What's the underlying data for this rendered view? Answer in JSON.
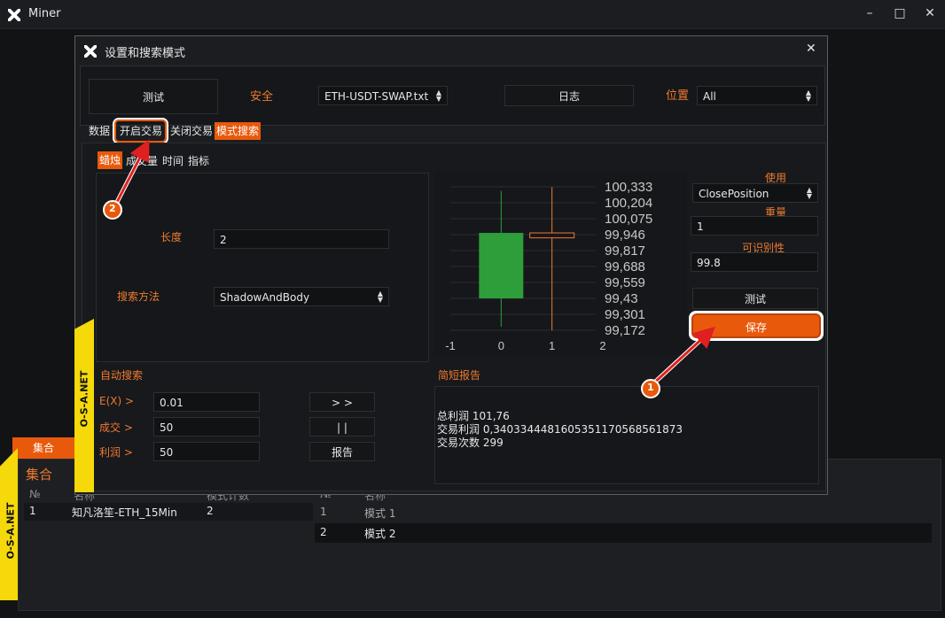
{
  "main": {
    "title": "Miner",
    "window_buttons": {
      "minimize": "–",
      "maximize": "□",
      "close": "✕"
    }
  },
  "collection": {
    "tab_label": "集合",
    "title": "集合",
    "left_headers": [
      "№",
      "名称",
      "模式计数"
    ],
    "left_rows": [
      [
        "1",
        "知凡洛笙-ETH_15Min",
        "2"
      ]
    ],
    "right_headers": [
      "№",
      "名称"
    ],
    "right_rows": [
      [
        "1",
        "模式 1"
      ],
      [
        "2",
        "模式 2"
      ]
    ]
  },
  "dialog": {
    "title": "设置和搜索模式",
    "close": "✕",
    "top": {
      "test_button": "测试",
      "security_label": "安全",
      "security_value": "ETH-USDT-SWAP.txt",
      "log_button": "日志",
      "position_label": "位置",
      "position_value": "All"
    },
    "tabs": [
      "数据",
      "开启交易",
      "关闭交易",
      "模式搜索"
    ],
    "active_tab": "模式搜索",
    "subtabs": [
      "蜡烛",
      "成交量",
      "时间",
      "指标"
    ],
    "params": {
      "length_label": "长度",
      "length_value": "2",
      "method_label": "搜索方法",
      "method_value": "ShadowAndBody"
    },
    "auto_search": {
      "title": "自动搜索",
      "rows": [
        {
          "label": "E(X) >",
          "value": "0.01",
          "button": "> >"
        },
        {
          "label": "成交 >",
          "value": "50",
          "button": "| |"
        },
        {
          "label": "利润 >",
          "value": "50",
          "button": "报告"
        }
      ]
    },
    "right_panel": {
      "use_label": "使用",
      "use_value": "ClosePosition",
      "weight_label": "重量",
      "weight_value": "1",
      "recognition_label": "可识别性",
      "recognition_value": "99.8",
      "test_button": "测试",
      "save_button": "保存"
    },
    "report": {
      "title": "简短报告",
      "lines": [
        "总利润 101,76",
        "交易利润 0,34033444816053511705685618​73",
        "交易次数 299"
      ]
    }
  },
  "chart_data": {
    "type": "candlestick",
    "x_ticks": [
      "-1",
      "0",
      "1",
      "2"
    ],
    "y_ticks": [
      "100,333",
      "100,204",
      "100,075",
      "99,946",
      "99,817",
      "99,688",
      "99,559",
      "99,43",
      "99,301",
      "99,172"
    ],
    "candles": [
      {
        "x": 0,
        "open": 99.43,
        "close": 99.96,
        "high": 100.3,
        "low": 99.2,
        "color": "#2e9e3a"
      },
      {
        "x": 1,
        "open": 99.96,
        "close": 99.92,
        "high": 100.33,
        "low": 99.17,
        "color": "#f07a2f"
      }
    ]
  },
  "annotations": [
    {
      "number": "1",
      "target": "save-button"
    },
    {
      "number": "2",
      "target": "tab-open-trade"
    }
  ],
  "banner_text": "O-S-A.NET",
  "colors": {
    "accent": "#e8590c",
    "label": "#f07a2f",
    "bull": "#2e9e3a",
    "banner": "#f5d90a",
    "arrow": "#e02020"
  }
}
